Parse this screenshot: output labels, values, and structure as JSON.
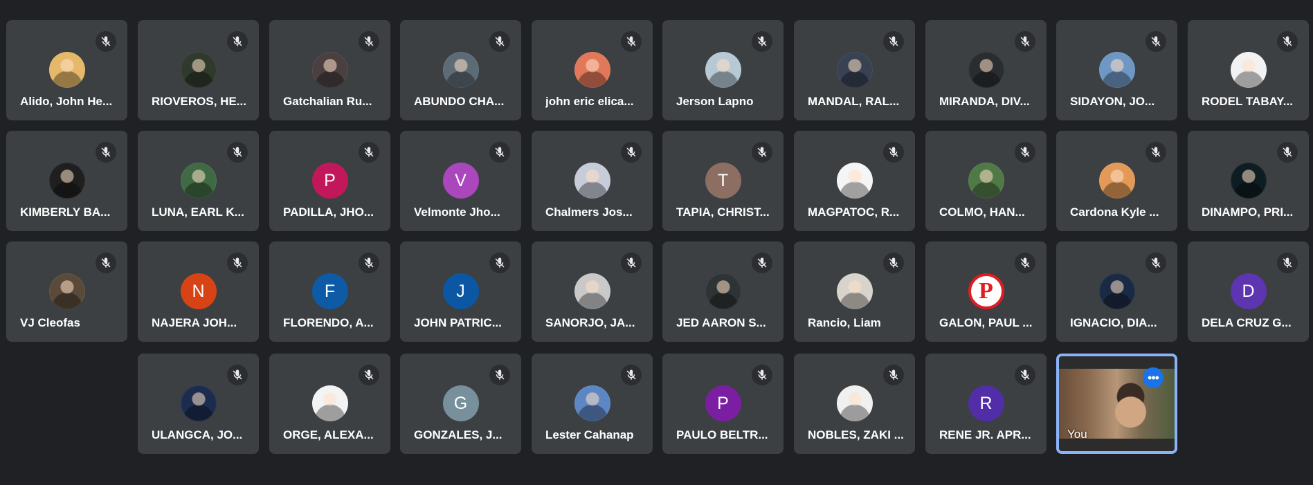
{
  "self_label": "You",
  "participants": [
    {
      "name": "Alido, John He...",
      "avatar": "cat-photo",
      "color": "#e6b86a"
    },
    {
      "name": "RIOVEROS, HE...",
      "avatar": "photo",
      "color": "#2f3a2c"
    },
    {
      "name": "Gatchalian Ru...",
      "avatar": "photo",
      "color": "#4a4040"
    },
    {
      "name": "ABUNDO CHA...",
      "avatar": "photo",
      "color": "#5c6b75"
    },
    {
      "name": "john eric elica...",
      "avatar": "photo",
      "color": "#e2785a"
    },
    {
      "name": "Jerson Lapno",
      "avatar": "photo",
      "color": "#b7c9d4"
    },
    {
      "name": "MANDAL, RAL...",
      "avatar": "photo",
      "color": "#384253"
    },
    {
      "name": "MIRANDA, DIV...",
      "avatar": "photo",
      "color": "#2a2d30"
    },
    {
      "name": "SIDAYON, JO...",
      "avatar": "photo",
      "color": "#6e97c4"
    },
    {
      "name": "RODEL TABAY...",
      "avatar": "photo",
      "color": "#f2f2f2"
    },
    {
      "name": "KIMBERLY BA...",
      "avatar": "photo",
      "color": "#1f1f1f"
    },
    {
      "name": "LUNA, EARL K...",
      "avatar": "photo",
      "color": "#3f6a44"
    },
    {
      "name": "PADILLA, JHO...",
      "avatar": "letter",
      "letter": "P",
      "color": "#c2185b"
    },
    {
      "name": "Velmonte Jho...",
      "avatar": "letter",
      "letter": "V",
      "color": "#ab47bc"
    },
    {
      "name": "Chalmers Jos...",
      "avatar": "photo",
      "color": "#c8ccd8"
    },
    {
      "name": "TAPIA, CHRIST...",
      "avatar": "letter",
      "letter": "T",
      "color": "#8d6e63"
    },
    {
      "name": "MAGPATOC, R...",
      "avatar": "photo",
      "color": "#f5f5f5"
    },
    {
      "name": "COLMO, HAN...",
      "avatar": "photo",
      "color": "#4f7a46"
    },
    {
      "name": "Cardona Kyle ...",
      "avatar": "photo",
      "color": "#e39a58"
    },
    {
      "name": "DINAMPO, PRI...",
      "avatar": "photo",
      "color": "#0e1d22"
    },
    {
      "name": "VJ Cleofas",
      "avatar": "photo",
      "color": "#5b4a3a"
    },
    {
      "name": "NAJERA JOH...",
      "avatar": "letter",
      "letter": "N",
      "color": "#d84315"
    },
    {
      "name": "FLORENDO, A...",
      "avatar": "letter",
      "letter": "F",
      "color": "#0d5aa7"
    },
    {
      "name": "JOHN PATRIC...",
      "avatar": "letter",
      "letter": "J",
      "color": "#0b57a4"
    },
    {
      "name": "SANORJO, JA...",
      "avatar": "photo",
      "color": "#c9c9c9"
    },
    {
      "name": "JED AARON S...",
      "avatar": "photo",
      "color": "#2e3436"
    },
    {
      "name": "Rancio, Liam",
      "avatar": "photo",
      "color": "#d8d3cb"
    },
    {
      "name": "GALON, PAUL ...",
      "avatar": "logo",
      "letter": "P",
      "color": "#e01b22"
    },
    {
      "name": "IGNACIO, DIA...",
      "avatar": "photo",
      "color": "#1b2a44"
    },
    {
      "name": "DELA CRUZ G...",
      "avatar": "letter",
      "letter": "D",
      "color": "#5e35b1"
    },
    {
      "name": "ULANGCA, JO...",
      "avatar": "photo",
      "color": "#1c2c4f"
    },
    {
      "name": "ORGE, ALEXA...",
      "avatar": "photo",
      "color": "#f3f3f3"
    },
    {
      "name": "GONZALES, J...",
      "avatar": "letter",
      "letter": "G",
      "color": "#78909c"
    },
    {
      "name": "Lester Cahanap",
      "avatar": "photo",
      "color": "#5d86c4"
    },
    {
      "name": "PAULO BELTR...",
      "avatar": "letter",
      "letter": "P",
      "color": "#7b1fa2"
    },
    {
      "name": "NOBLES, ZAKI ...",
      "avatar": "photo",
      "color": "#f0f0f0"
    },
    {
      "name": "RENE JR. APR...",
      "avatar": "letter",
      "letter": "R",
      "color": "#512da8"
    }
  ]
}
